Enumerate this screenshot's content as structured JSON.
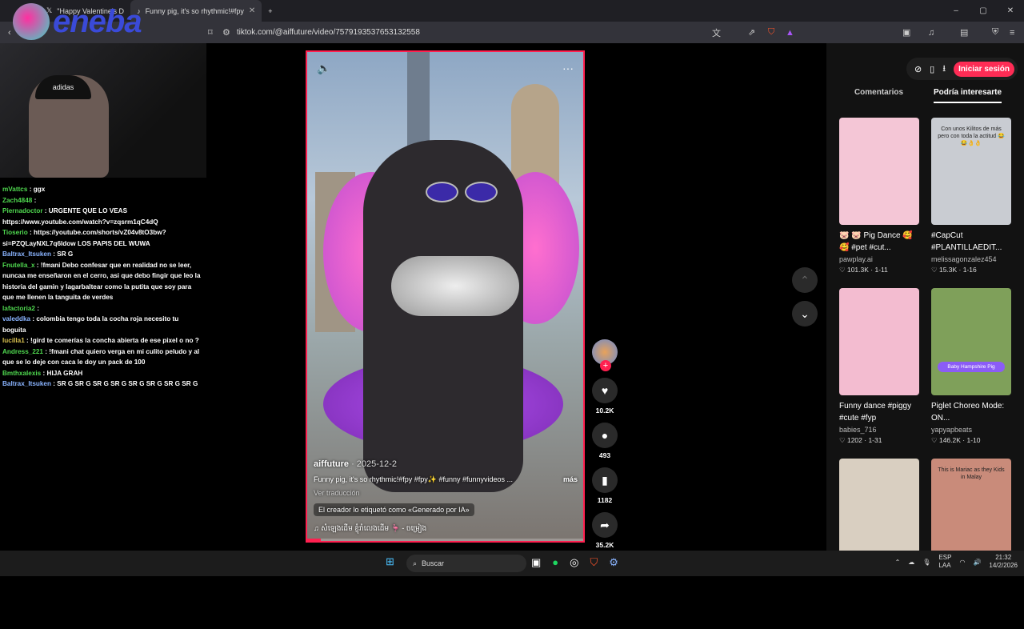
{
  "browser": {
    "tabs": [
      {
        "label": "\"Happy Valentine's D",
        "active": false
      },
      {
        "label": "Funny pig, it's so rhythmic!#fpy",
        "active": true
      }
    ],
    "new_tab": "+",
    "url": "tiktok.com/@aiffuture/video/7579193537653132558",
    "window_controls": [
      "–",
      "▢",
      "✕"
    ]
  },
  "overlay": {
    "logo_text": "eneba"
  },
  "chat": [
    {
      "user": "mVattcs",
      "text": ": ggx"
    },
    {
      "user": "Zach4848",
      "text": ":"
    },
    {
      "user": "Piernadoctor",
      "text": ": URGENTE QUE LO VEAS https://www.youtube.com/watch?v=zqsrm1qC4dQ"
    },
    {
      "user": "Tioserio",
      "text": ": https://youtube.com/shorts/vZ04v8tO3bw?si=PZQLayNXL7q6ldow LOS PAPIS DEL WUWA"
    },
    {
      "user": "Baltrax_Itsuken",
      "text": ": SR G"
    },
    {
      "user": "Fnutella_x",
      "text": ": !fmani Debo confesar que en realidad no se leer, nuncaa me enseñaron en el cerro, asi que debo fingir que leo la historia del gamin y lagarbaltear como la putita que soy para que me llenen la tanguita de verdes"
    },
    {
      "user": "lafactoria2",
      "text": ":"
    },
    {
      "user": "valeddka",
      "text": ": colombia tengo toda la cocha roja necesito tu boguita"
    },
    {
      "user": "lucilla1",
      "text": ": !gird te comerías la concha abierta de ese pixel o no ?"
    },
    {
      "user": "Andress_221",
      "text": ": !fmani chat quiero verga en mi culito peludo y al que se lo deje con caca le doy un pack de 100"
    },
    {
      "user": "Bmthxalexis",
      "text": ": HIJA GRAH"
    },
    {
      "user": "Baltrax_Itsuken",
      "text": ": SR G SR G SR G SR G SR G SR G SR G SR G"
    }
  ],
  "cam": {
    "cap_text": "adidas"
  },
  "video": {
    "mute_icon": "speaker-icon",
    "more_label": "···",
    "author": "aiffuture",
    "date": "· 2025-12-2",
    "description": "Funny pig, it's so rhythmic!#fpy #fpy✨ #funny #funnyvideos ...",
    "more": "más",
    "translate": "Ver traducción",
    "ai_tag": "El creador lo etiquetó como «Generado por IA»",
    "music": "♫  សំឡេងដើម ខ្ញុំរាំលេងដើម 🦩 - ចម្រៀង",
    "progress": 0.05
  },
  "actions": {
    "likes": "10.2K",
    "comments": "493",
    "saves": "1182",
    "shares": "35.2K"
  },
  "right_panel": {
    "login": "Iniciar sesión",
    "tabs": [
      "Comentarios",
      "Podría interesarte"
    ],
    "active_tab": 1,
    "cards": [
      {
        "title": "🐷 🐷 Pig Dance 🥰 🥰 #pet #cut...",
        "author": "pawplay.ai",
        "stats": "♡ 101.3K · 1-11",
        "thumb_text": "",
        "color": "#f4c6d6"
      },
      {
        "title": "#CapCut #PLANTILLAEDIT...",
        "author": "melissagonzalez454",
        "stats": "♡ 15.3K · 1-16",
        "thumb_text": "Con unos Kilitos de más pero con toda la actitud 😂😂👌👌",
        "color": "#c9ccd2"
      },
      {
        "title": "Funny dance #piggy #cute #fyp",
        "author": "babies_716",
        "stats": "♡ 1202 · 1-31",
        "thumb_text": "",
        "color": "#f3bcd0"
      },
      {
        "title": "Piglet Choreo Mode: ON...",
        "author": "yapyapbeats",
        "stats": "♡ 146.2K · 1-10",
        "thumb_text": "",
        "badge": "Baby Hampshire Pig",
        "color": "#7fa05a"
      },
      {
        "title": "",
        "author": "",
        "stats": "",
        "thumb_text": "",
        "color": "#d9cfc1"
      },
      {
        "title": "",
        "author": "",
        "stats": "",
        "thumb_text": "This is Mariac as they Kids in Malay",
        "color": "#c98b7a"
      }
    ]
  },
  "taskbar": {
    "search": "Buscar",
    "lang": "ESP\nLAA",
    "time": "21:32",
    "date": "14/2/2026"
  }
}
